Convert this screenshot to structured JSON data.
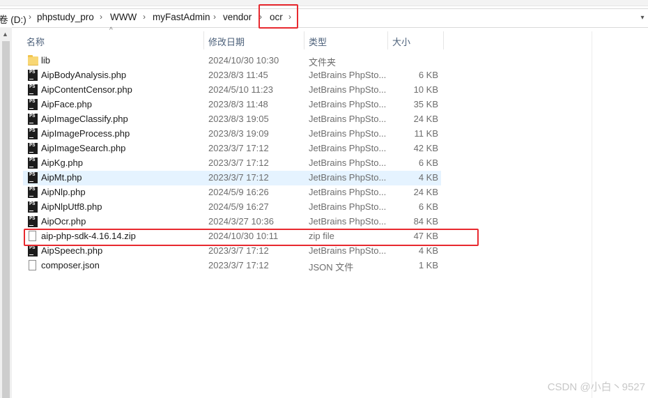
{
  "address": {
    "crumbs": [
      "卷 (D:)",
      "phpstudy_pro",
      "WWW",
      "myFastAdmin",
      "vendor",
      "ocr"
    ]
  },
  "columns": {
    "name": "名称",
    "date": "修改日期",
    "type": "类型",
    "size": "大小"
  },
  "files": [
    {
      "name": "lib",
      "date": "2024/10/30 10:30",
      "type": "文件夹",
      "size": "",
      "icon": "folder-icon"
    },
    {
      "name": "AipBodyAnalysis.php",
      "date": "2023/8/3 11:45",
      "type": "JetBrains PhpSto...",
      "size": "6 KB",
      "icon": "phpstorm-file-icon"
    },
    {
      "name": "AipContentCensor.php",
      "date": "2024/5/10 11:23",
      "type": "JetBrains PhpSto...",
      "size": "10 KB",
      "icon": "phpstorm-file-icon"
    },
    {
      "name": "AipFace.php",
      "date": "2023/8/3 11:48",
      "type": "JetBrains PhpSto...",
      "size": "35 KB",
      "icon": "phpstorm-file-icon"
    },
    {
      "name": "AipImageClassify.php",
      "date": "2023/8/3 19:05",
      "type": "JetBrains PhpSto...",
      "size": "24 KB",
      "icon": "phpstorm-file-icon"
    },
    {
      "name": "AipImageProcess.php",
      "date": "2023/8/3 19:09",
      "type": "JetBrains PhpSto...",
      "size": "11 KB",
      "icon": "phpstorm-file-icon"
    },
    {
      "name": "AipImageSearch.php",
      "date": "2023/3/7 17:12",
      "type": "JetBrains PhpSto...",
      "size": "42 KB",
      "icon": "phpstorm-file-icon"
    },
    {
      "name": "AipKg.php",
      "date": "2023/3/7 17:12",
      "type": "JetBrains PhpSto...",
      "size": "6 KB",
      "icon": "phpstorm-file-icon"
    },
    {
      "name": "AipMt.php",
      "date": "2023/3/7 17:12",
      "type": "JetBrains PhpSto...",
      "size": "4 KB",
      "icon": "phpstorm-file-icon"
    },
    {
      "name": "AipNlp.php",
      "date": "2024/5/9 16:26",
      "type": "JetBrains PhpSto...",
      "size": "24 KB",
      "icon": "phpstorm-file-icon"
    },
    {
      "name": "AipNlpUtf8.php",
      "date": "2024/5/9 16:27",
      "type": "JetBrains PhpSto...",
      "size": "6 KB",
      "icon": "phpstorm-file-icon"
    },
    {
      "name": "AipOcr.php",
      "date": "2024/3/27 10:36",
      "type": "JetBrains PhpSto...",
      "size": "84 KB",
      "icon": "phpstorm-file-icon"
    },
    {
      "name": "aip-php-sdk-4.16.14.zip",
      "date": "2024/10/30 10:11",
      "type": "zip file",
      "size": "47 KB",
      "icon": "zip-file-icon"
    },
    {
      "name": "AipSpeech.php",
      "date": "2023/3/7 17:12",
      "type": "JetBrains PhpSto...",
      "size": "4 KB",
      "icon": "phpstorm-file-icon"
    },
    {
      "name": "composer.json",
      "date": "2023/3/7 17:12",
      "type": "JSON 文件",
      "size": "1 KB",
      "icon": "json-file-icon"
    }
  ],
  "watermark": "CSDN @小白丶9527",
  "colors": {
    "highlight": "#e8292f",
    "hover_row": "#e5f3ff",
    "header_text": "#4c607a"
  }
}
